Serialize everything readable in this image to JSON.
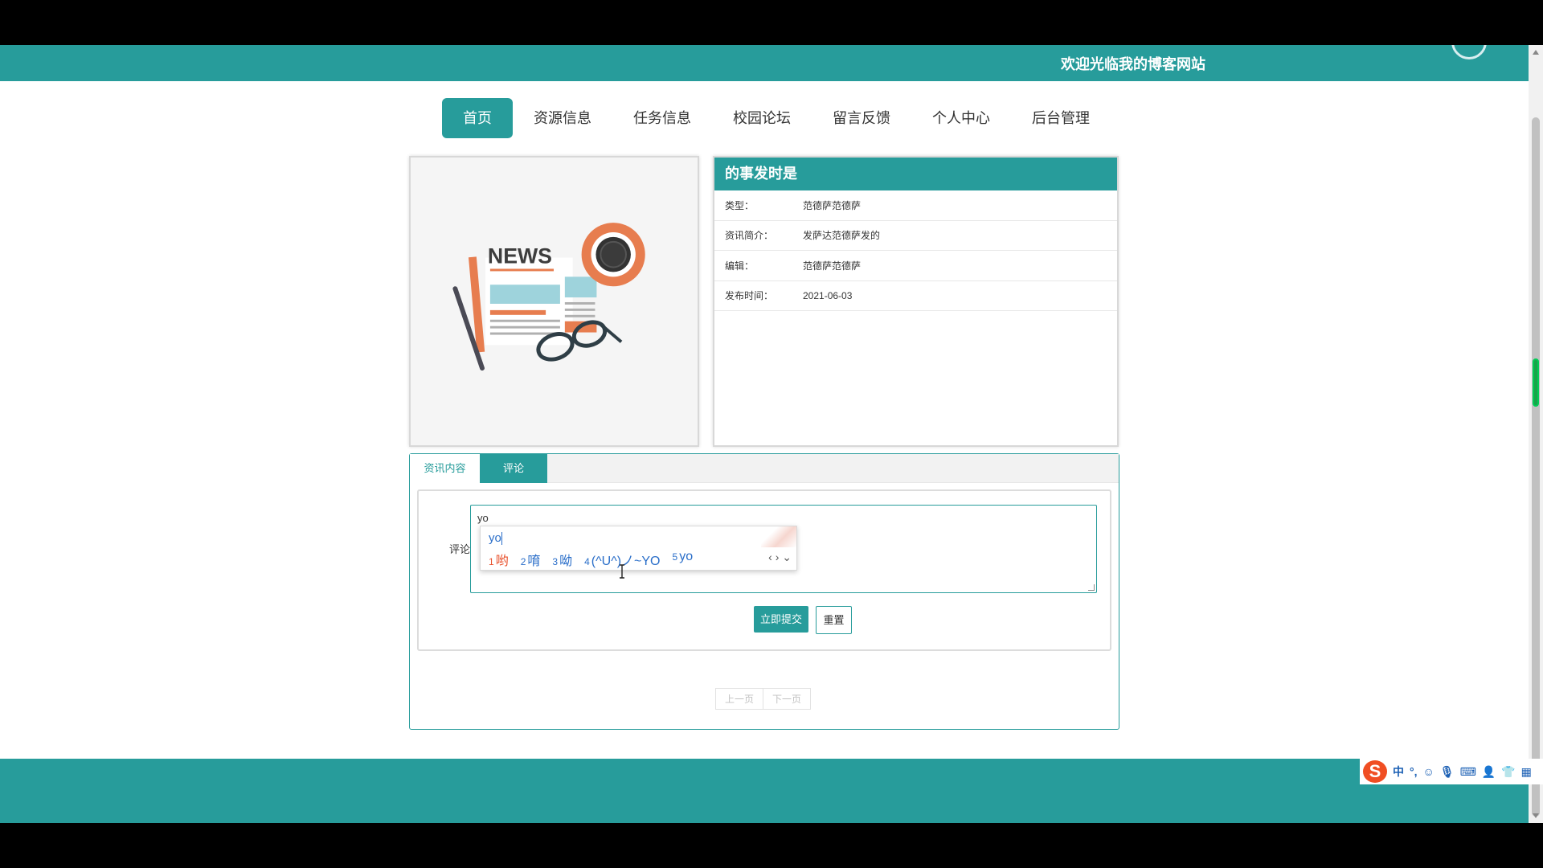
{
  "header": {
    "welcome": "欢迎光临我的博客网站"
  },
  "nav": {
    "items": [
      {
        "label": "首页",
        "active": true
      },
      {
        "label": "资源信息",
        "active": false
      },
      {
        "label": "任务信息",
        "active": false
      },
      {
        "label": "校园论坛",
        "active": false
      },
      {
        "label": "留言反馈",
        "active": false
      },
      {
        "label": "个人中心",
        "active": false
      },
      {
        "label": "后台管理",
        "active": false
      }
    ]
  },
  "news_image": {
    "text": "NEWS"
  },
  "info": {
    "title": "的事发时是",
    "rows": [
      {
        "key": "类型：",
        "value": "范德萨范德萨"
      },
      {
        "key": "资讯简介：",
        "value": "发萨达范德萨发的"
      },
      {
        "key": "编辑：",
        "value": "范德萨范德萨"
      },
      {
        "key": "发布时间：",
        "value": "2021-06-03"
      }
    ]
  },
  "tabs": {
    "content_label": "资讯内容",
    "comment_label": "评论",
    "active": "评论"
  },
  "comment_form": {
    "label": "评论",
    "value": "yo",
    "submit_label": "立即提交",
    "reset_label": "重置"
  },
  "ime_popup": {
    "composition": "yo",
    "candidates": [
      {
        "num": "1",
        "text": "哟"
      },
      {
        "num": "2",
        "text": "唷"
      },
      {
        "num": "3",
        "text": "呦"
      },
      {
        "num": "4",
        "text": "(^U^)ノ~YO"
      },
      {
        "num": "5",
        "text": "yo"
      }
    ],
    "arrows": "‹ › ⌄"
  },
  "pager": {
    "prev_label": "上一页",
    "next_label": "下一页"
  },
  "ime_toolbar": {
    "logo": "S",
    "mode": "中",
    "punct": "°,",
    "icons": [
      "emoji-icon",
      "microphone-icon",
      "keyboard-icon",
      "user-icon",
      "shirt-icon",
      "apps-icon"
    ]
  },
  "colors": {
    "brand": "#279c9b",
    "ime_logo": "#f04e23"
  }
}
